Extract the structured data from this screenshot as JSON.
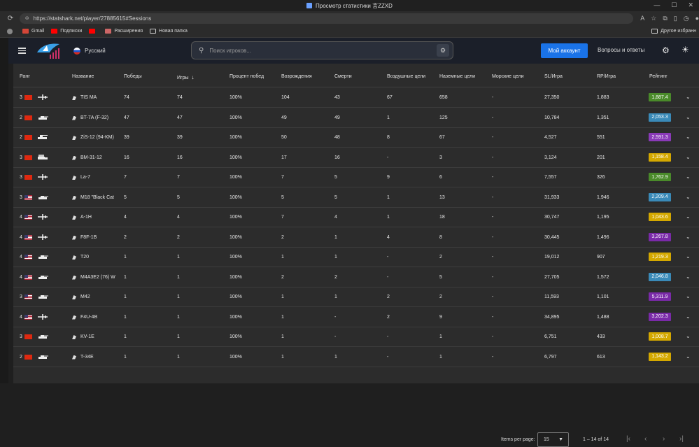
{
  "window": {
    "title": "Просмотр статистики 言ZZXD"
  },
  "browser": {
    "url": "https://statshark.net/player/27885615#Sessions",
    "bookmarks": [
      "Gmail",
      "Подписки",
      "",
      "Расширения",
      "Новая папка"
    ],
    "bookmarks_right": "Другое избранн"
  },
  "header": {
    "language": "Русский",
    "search_placeholder": "Поиск игроков...",
    "account_button": "Мой аккаунт",
    "qa_link": "Вопросы и ответы"
  },
  "table": {
    "columns": [
      "Ранг",
      "Название",
      "Победы",
      "Игры",
      "Процент побед",
      "Возрождения",
      "Смерти",
      "Воздушные цели",
      "Наземные цели",
      "Морские цели",
      "SL/Игра",
      "RP/Игра",
      "Рейтинг"
    ],
    "sort_column": "Игры",
    "rows": [
      {
        "rank": "3",
        "nation": "cn",
        "type": "plane",
        "name": "TIS MA",
        "wins": "74",
        "games": "74",
        "winrate": "100%",
        "spawns": "104",
        "deaths": "43",
        "air": "67",
        "ground": "658",
        "naval": "-",
        "sl": "27,350",
        "rp": "1,883",
        "rating": "1,887.4",
        "color": "#4a8a2a"
      },
      {
        "rank": "2",
        "nation": "cn",
        "type": "tank",
        "name": "BT-7A (F-32)",
        "wins": "47",
        "games": "47",
        "winrate": "100%",
        "spawns": "49",
        "deaths": "49",
        "air": "1",
        "ground": "125",
        "naval": "-",
        "sl": "10,784",
        "rp": "1,351",
        "rating": "2,053.3",
        "color": "#3a8ab8"
      },
      {
        "rank": "2",
        "nation": "cn",
        "type": "spaa",
        "name": "ZiS-12 (94-KM)",
        "wins": "39",
        "games": "39",
        "winrate": "100%",
        "spawns": "50",
        "deaths": "48",
        "air": "8",
        "ground": "67",
        "naval": "-",
        "sl": "4,527",
        "rp": "551",
        "rating": "2,591.3",
        "color": "#8a3ab8"
      },
      {
        "rank": "3",
        "nation": "cn",
        "type": "truck",
        "name": "BM-31-12",
        "wins": "16",
        "games": "16",
        "winrate": "100%",
        "spawns": "17",
        "deaths": "16",
        "air": "-",
        "ground": "3",
        "naval": "-",
        "sl": "3,124",
        "rp": "201",
        "rating": "1,158.4",
        "color": "#d4a800"
      },
      {
        "rank": "3",
        "nation": "cn",
        "type": "plane",
        "name": "La-7",
        "wins": "7",
        "games": "7",
        "winrate": "100%",
        "spawns": "7",
        "deaths": "5",
        "air": "9",
        "ground": "6",
        "naval": "-",
        "sl": "7,557",
        "rp": "326",
        "rating": "1,762.9",
        "color": "#4a8a2a"
      },
      {
        "rank": "3",
        "nation": "us",
        "type": "tank",
        "name": "M18 \"Black Cat",
        "wins": "5",
        "games": "5",
        "winrate": "100%",
        "spawns": "5",
        "deaths": "5",
        "air": "1",
        "ground": "13",
        "naval": "-",
        "sl": "31,933",
        "rp": "1,946",
        "rating": "2,209.4",
        "color": "#3a8ab8"
      },
      {
        "rank": "4",
        "nation": "us",
        "type": "plane",
        "name": "A-1H",
        "wins": "4",
        "games": "4",
        "winrate": "100%",
        "spawns": "7",
        "deaths": "4",
        "air": "1",
        "ground": "18",
        "naval": "-",
        "sl": "30,747",
        "rp": "1,195",
        "rating": "1,043.6",
        "color": "#d4a800"
      },
      {
        "rank": "4",
        "nation": "us",
        "type": "plane",
        "name": "F8F-1B",
        "wins": "2",
        "games": "2",
        "winrate": "100%",
        "spawns": "2",
        "deaths": "1",
        "air": "4",
        "ground": "8",
        "naval": "-",
        "sl": "30,445",
        "rp": "1,496",
        "rating": "3,267.8",
        "color": "#7a2aa8"
      },
      {
        "rank": "4",
        "nation": "us",
        "type": "tank",
        "name": "T20",
        "wins": "1",
        "games": "1",
        "winrate": "100%",
        "spawns": "1",
        "deaths": "1",
        "air": "-",
        "ground": "2",
        "naval": "-",
        "sl": "19,012",
        "rp": "907",
        "rating": "1,219.3",
        "color": "#d4a800"
      },
      {
        "rank": "4",
        "nation": "us",
        "type": "tank",
        "name": "M4A3E2 (76) W",
        "wins": "1",
        "games": "1",
        "winrate": "100%",
        "spawns": "2",
        "deaths": "2",
        "air": "-",
        "ground": "5",
        "naval": "-",
        "sl": "27,705",
        "rp": "1,572",
        "rating": "2,046.8",
        "color": "#3a8ab8"
      },
      {
        "rank": "3",
        "nation": "us",
        "type": "tank",
        "name": "M42",
        "wins": "1",
        "games": "1",
        "winrate": "100%",
        "spawns": "1",
        "deaths": "1",
        "air": "2",
        "ground": "2",
        "naval": "-",
        "sl": "11,593",
        "rp": "1,101",
        "rating": "5,311.9",
        "color": "#7a2aa8"
      },
      {
        "rank": "4",
        "nation": "us",
        "type": "plane",
        "name": "F4U-4B",
        "wins": "1",
        "games": "1",
        "winrate": "100%",
        "spawns": "1",
        "deaths": "-",
        "air": "2",
        "ground": "9",
        "naval": "-",
        "sl": "34,895",
        "rp": "1,488",
        "rating": "3,202.3",
        "color": "#7a2aa8"
      },
      {
        "rank": "3",
        "nation": "cn",
        "type": "tank",
        "name": "KV-1E",
        "wins": "1",
        "games": "1",
        "winrate": "100%",
        "spawns": "1",
        "deaths": "-",
        "air": "-",
        "ground": "1",
        "naval": "-",
        "sl": "6,751",
        "rp": "433",
        "rating": "1,008.7",
        "color": "#d4a800"
      },
      {
        "rank": "2",
        "nation": "cn",
        "type": "tank",
        "name": "T-34E",
        "wins": "1",
        "games": "1",
        "winrate": "100%",
        "spawns": "1",
        "deaths": "1",
        "air": "-",
        "ground": "1",
        "naval": "-",
        "sl": "6,797",
        "rp": "613",
        "rating": "1,143.2",
        "color": "#d4a800"
      }
    ]
  },
  "pager": {
    "items_label": "Items per page:",
    "page_size": "15",
    "range": "1 – 14 of 14"
  }
}
